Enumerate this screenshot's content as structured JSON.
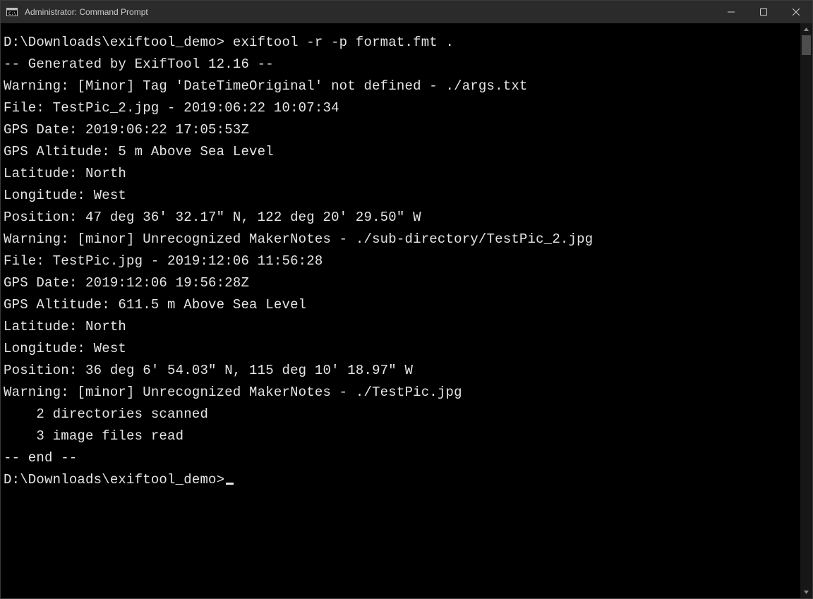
{
  "titlebar": {
    "title": "Administrator: Command Prompt"
  },
  "prompt1": {
    "path": "D:\\Downloads\\exiftool_demo>",
    "command": " exiftool -r -p format.fmt ."
  },
  "lines": {
    "l1": "-- Generated by ExifTool 12.16 --",
    "l2": "",
    "l3": "Warning: [Minor] Tag 'DateTimeOriginal' not defined - ./args.txt",
    "l4": "File: TestPic_2.jpg - 2019:06:22 10:07:34",
    "l5": "GPS Date: 2019:06:22 17:05:53Z",
    "l6": "GPS Altitude: 5 m Above Sea Level",
    "l7": "Latitude: North",
    "l8": "Longitude: West",
    "l9": "Position: 47 deg 36' 32.17\" N, 122 deg 20' 29.50\" W",
    "l10": "",
    "l11": "Warning: [minor] Unrecognized MakerNotes - ./sub-directory/TestPic_2.jpg",
    "l12": "File: TestPic.jpg - 2019:12:06 11:56:28",
    "l13": "GPS Date: 2019:12:06 19:56:28Z",
    "l14": "GPS Altitude: 611.5 m Above Sea Level",
    "l15": "Latitude: North",
    "l16": "Longitude: West",
    "l17": "Position: 36 deg 6' 54.03\" N, 115 deg 10' 18.97\" W",
    "l18": "",
    "l19": "Warning: [minor] Unrecognized MakerNotes - ./TestPic.jpg",
    "l20": "    2 directories scanned",
    "l21": "    3 image files read",
    "l22": "-- end --"
  },
  "prompt2": {
    "path": "D:\\Downloads\\exiftool_demo>"
  }
}
